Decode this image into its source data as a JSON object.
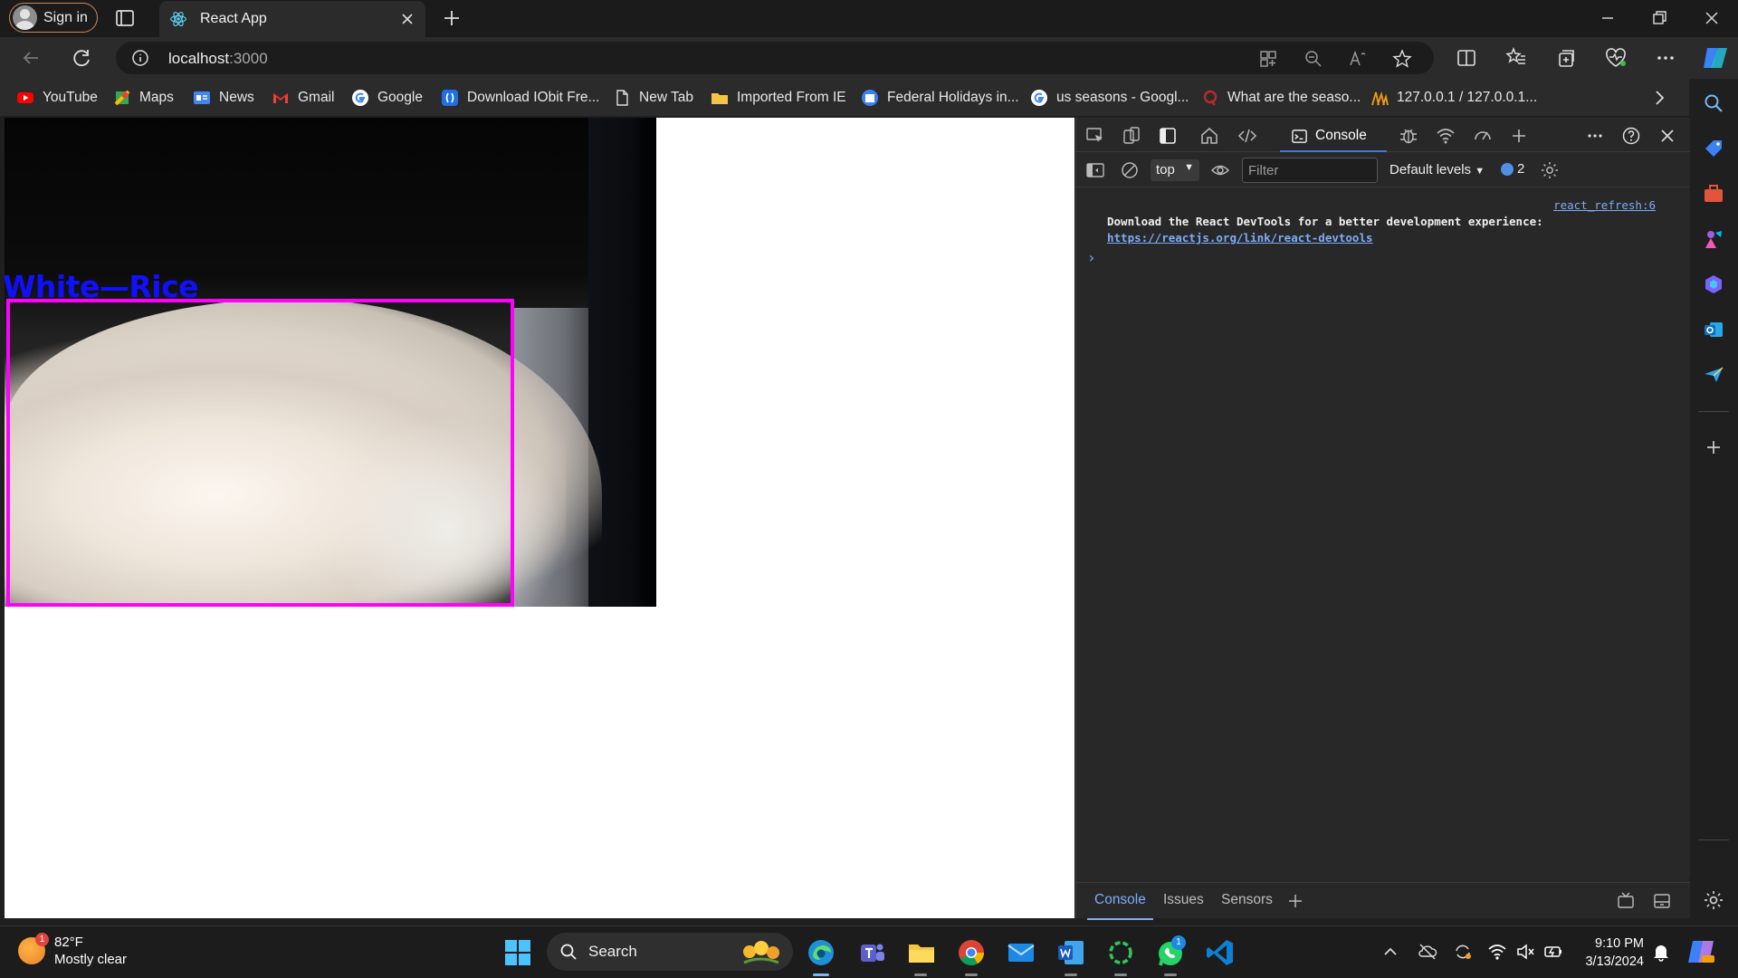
{
  "browser": {
    "signin_label": "Sign in",
    "tab_title": "React App",
    "url_host": "localhost",
    "url_port": ":3000"
  },
  "bookmarks": [
    {
      "label": "YouTube",
      "icon": "youtube-icon"
    },
    {
      "label": "Maps",
      "icon": "maps-icon"
    },
    {
      "label": "News",
      "icon": "news-icon"
    },
    {
      "label": "Gmail",
      "icon": "gmail-icon"
    },
    {
      "label": "Google",
      "icon": "google-icon"
    },
    {
      "label": "Download IObit Fre...",
      "icon": "iobit-icon"
    },
    {
      "label": "New Tab",
      "icon": "page-icon"
    },
    {
      "label": "Imported From IE",
      "icon": "folder-icon"
    },
    {
      "label": "Federal Holidays in...",
      "icon": "calendar-icon"
    },
    {
      "label": "us seasons - Googl...",
      "icon": "google-icon"
    },
    {
      "label": "What are the seaso...",
      "icon": "quora-icon"
    },
    {
      "label": "127.0.0.1 / 127.0.0.1...",
      "icon": "phpmyadmin-icon"
    }
  ],
  "page": {
    "detection_label": "White—Rice"
  },
  "devtools": {
    "console_tab": "Console",
    "context": "top",
    "filter_placeholder": "Filter",
    "levels": "Default levels",
    "issue_count": "2",
    "source_link": "react_refresh:6",
    "message_text": "Download the React DevTools for a better development experience: ",
    "message_link": "https://reactjs.org/link/react-devtools",
    "drawer_tabs": [
      "Console",
      "Issues",
      "Sensors"
    ]
  },
  "taskbar": {
    "temperature": "82°F",
    "weather_desc": "Mostly clear",
    "weather_badge": "1",
    "search_label": "Search",
    "whatsapp_badge": "1",
    "time": "9:10 PM",
    "date": "3/13/2024"
  },
  "colors": {
    "bbox": "#ff00ff",
    "label": "#1010ff",
    "accent": "#7cacf8"
  }
}
